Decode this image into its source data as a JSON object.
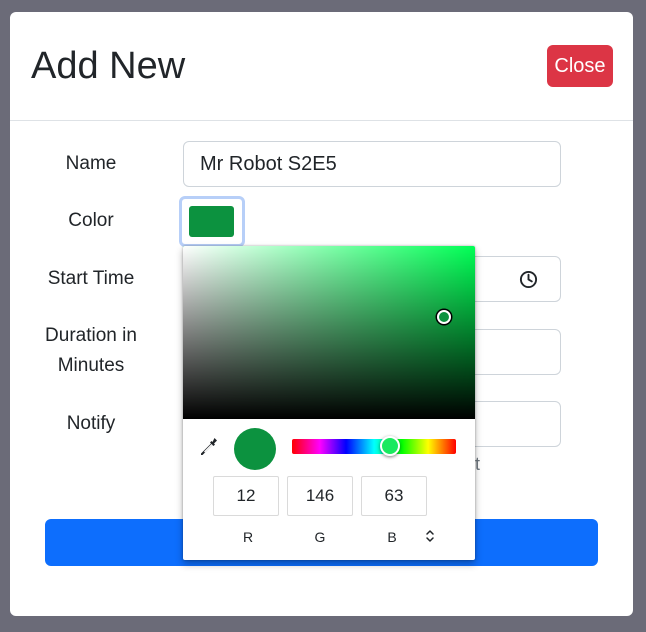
{
  "modal": {
    "title": "Add New",
    "close_label": "Close"
  },
  "form": {
    "name_label": "Name",
    "name_value": "Mr Robot S2E5",
    "color_label": "Color",
    "color_value": "#0c923f",
    "start_time_label": "Start Time",
    "duration_label_line1": "Duration in",
    "duration_label_line2": "Minutes",
    "notify_label": "Notify",
    "notify_helper_tail": "t",
    "submit_color": "#0d6efd"
  },
  "color_picker": {
    "hue_color": "#00ff55",
    "hue_handle_color": "#1ae95f",
    "r_value": "12",
    "g_value": "146",
    "b_value": "63",
    "r_label": "R",
    "g_label": "G",
    "b_label": "B",
    "icons": [
      "eyedropper-icon",
      "chevron-up-down-icon"
    ]
  },
  "icons": [
    "clock-icon"
  ]
}
